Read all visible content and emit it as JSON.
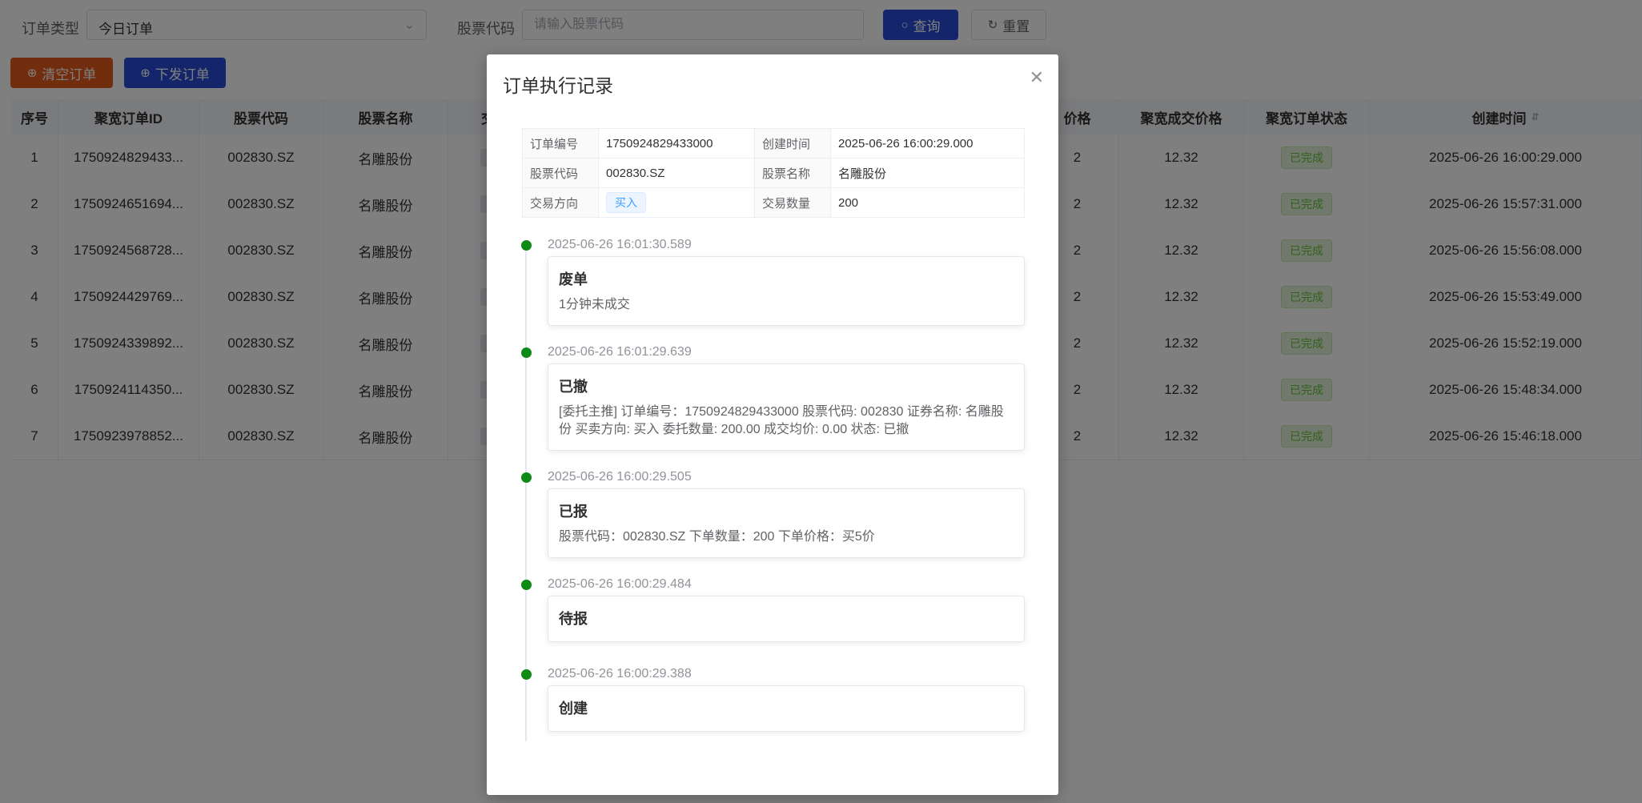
{
  "filters": {
    "order_type_label": "订单类型",
    "order_type_value": "今日订单",
    "stock_code_label": "股票代码",
    "stock_code_placeholder": "请输入股票代码",
    "search_label": "查询",
    "reset_label": "重置"
  },
  "actions": {
    "clear_label": "清空订单",
    "dispatch_label": "下发订单"
  },
  "table": {
    "headers": {
      "index": "序号",
      "order_id": "聚宽订单ID",
      "code": "股票代码",
      "name": "股票名称",
      "direction": "交",
      "price": "价格",
      "deal_price": "聚宽成交价格",
      "status": "聚宽订单状态",
      "created": "创建时间"
    },
    "rows": [
      {
        "index": "1",
        "order_id": "1750924829433...",
        "code": "002830.SZ",
        "name": "名雕股份",
        "price": "2",
        "deal_price": "12.32",
        "status": "已完成",
        "created": "2025-06-26 16:00:29.000"
      },
      {
        "index": "2",
        "order_id": "1750924651694...",
        "code": "002830.SZ",
        "name": "名雕股份",
        "price": "2",
        "deal_price": "12.32",
        "status": "已完成",
        "created": "2025-06-26 15:57:31.000"
      },
      {
        "index": "3",
        "order_id": "1750924568728...",
        "code": "002830.SZ",
        "name": "名雕股份",
        "price": "2",
        "deal_price": "12.32",
        "status": "已完成",
        "created": "2025-06-26 15:56:08.000"
      },
      {
        "index": "4",
        "order_id": "1750924429769...",
        "code": "002830.SZ",
        "name": "名雕股份",
        "price": "2",
        "deal_price": "12.32",
        "status": "已完成",
        "created": "2025-06-26 15:53:49.000"
      },
      {
        "index": "5",
        "order_id": "1750924339892...",
        "code": "002830.SZ",
        "name": "名雕股份",
        "price": "2",
        "deal_price": "12.32",
        "status": "已完成",
        "created": "2025-06-26 15:52:19.000"
      },
      {
        "index": "6",
        "order_id": "1750924114350...",
        "code": "002830.SZ",
        "name": "名雕股份",
        "price": "2",
        "deal_price": "12.32",
        "status": "已完成",
        "created": "2025-06-26 15:48:34.000"
      },
      {
        "index": "7",
        "order_id": "1750923978852...",
        "code": "002830.SZ",
        "name": "名雕股份",
        "price": "2",
        "deal_price": "12.32",
        "status": "已完成",
        "created": "2025-06-26 15:46:18.000"
      }
    ]
  },
  "dialog": {
    "title": "订单执行记录",
    "close_icon": "close-icon",
    "info": {
      "order_no_label": "订单编号",
      "order_no": "1750924829433000",
      "created_label": "创建时间",
      "created": "2025-06-26 16:00:29.000",
      "code_label": "股票代码",
      "code": "002830.SZ",
      "name_label": "股票名称",
      "name": "名雕股份",
      "direction_label": "交易方向",
      "direction": "买入",
      "qty_label": "交易数量",
      "qty": "200"
    },
    "timeline": [
      {
        "time": "2025-06-26 16:01:30.589",
        "title": "废单",
        "desc": "1分钟未成交"
      },
      {
        "time": "2025-06-26 16:01:29.639",
        "title": "已撤",
        "desc": "[委托主推] 订单编号：1750924829433000 股票代码: 002830 证券名称: 名雕股份 买卖方向: 买入 委托数量: 200.00 成交均价: 0.00 状态: 已撤"
      },
      {
        "time": "2025-06-26 16:00:29.505",
        "title": "已报",
        "desc": "股票代码：002830.SZ 下单数量：200 下单价格：买5价"
      },
      {
        "time": "2025-06-26 16:00:29.484",
        "title": "待报",
        "desc": ""
      },
      {
        "time": "2025-06-26 16:00:29.388",
        "title": "创建",
        "desc": ""
      }
    ]
  },
  "colors": {
    "primary": "#2b4bd8",
    "danger": "#e35a1c",
    "timeline_dot": "#0e8a16",
    "status_done": "#67c23a"
  }
}
